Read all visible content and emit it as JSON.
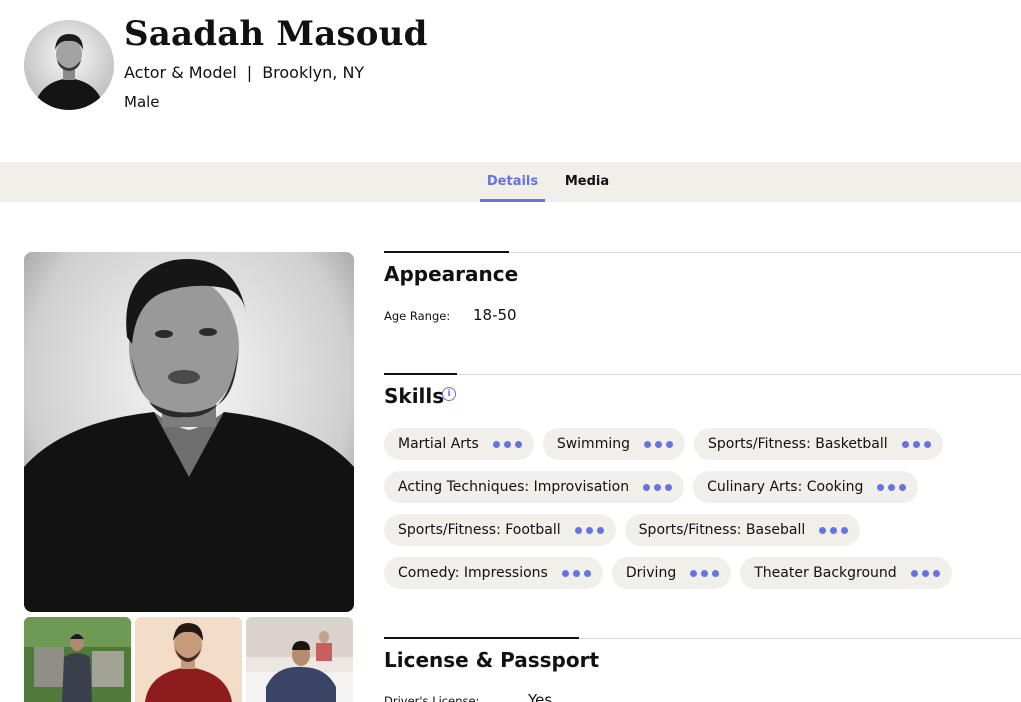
{
  "profile": {
    "name": "Saadah Masoud",
    "role": "Actor & Model",
    "separator": "|",
    "location": "Brooklyn, NY",
    "gender": "Male"
  },
  "tabs": [
    {
      "label": "Details",
      "active": true
    },
    {
      "label": "Media",
      "active": false
    }
  ],
  "appearance": {
    "title": "Appearance",
    "age_range_label": "Age Range:",
    "age_range_value": "18-50"
  },
  "skills": {
    "title": "Skills",
    "info_icon": "info-icon",
    "items": [
      "Martial Arts",
      "Swimming",
      "Sports/Fitness: Basketball",
      "Acting Techniques: Improvisation",
      "Culinary Arts: Cooking",
      "Sports/Fitness: Football",
      "Sports/Fitness: Baseball",
      "Comedy: Impressions",
      "Driving",
      "Theater Background"
    ]
  },
  "license": {
    "title": "License & Passport",
    "drivers_license_label": "Driver's License:",
    "drivers_license_value": "Yes"
  },
  "colors": {
    "accent": "#6573e3",
    "tab_bar_bg": "#f1efe9",
    "chip_bg": "#f1efe9"
  }
}
